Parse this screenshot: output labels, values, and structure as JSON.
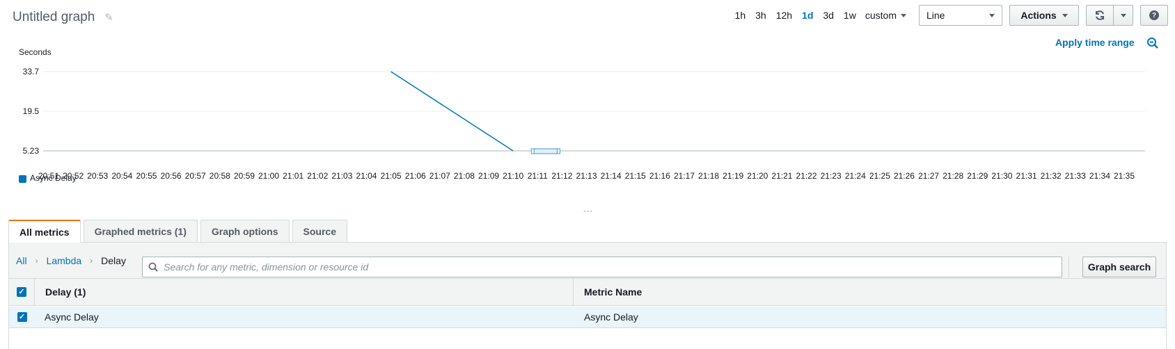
{
  "header": {
    "title": "Untitled graph",
    "edit_icon": "pencil-icon"
  },
  "toolbar": {
    "time_ranges": [
      "1h",
      "3h",
      "12h",
      "1d",
      "3d",
      "1w"
    ],
    "active_range": "1d",
    "custom_label": "custom",
    "graph_type": "Line",
    "actions_label": "Actions",
    "refresh_icon": "refresh-icon",
    "help_icon": "help-icon",
    "apply_time_range": "Apply time range",
    "zoom_icon": "zoom-out-icon"
  },
  "chart_data": {
    "type": "line",
    "ylabel": "Seconds",
    "yticks": [
      "33.7",
      "19.5",
      "5.23"
    ],
    "ylim": [
      5.23,
      33.7
    ],
    "x_categories": [
      "20:51",
      "20:52",
      "20:53",
      "20:54",
      "20:55",
      "20:56",
      "20:57",
      "20:58",
      "20:59",
      "21:00",
      "21:01",
      "21:02",
      "21:03",
      "21:04",
      "21:05",
      "21:06",
      "21:07",
      "21:08",
      "21:09",
      "21:10",
      "21:11",
      "21:12",
      "21:13",
      "21:14",
      "21:15",
      "21:16",
      "21:17",
      "21:18",
      "21:19",
      "21:20",
      "21:21",
      "21:22",
      "21:23",
      "21:24",
      "21:25",
      "21:26",
      "21:27",
      "21:28",
      "21:29",
      "21:30",
      "21:31",
      "21:32",
      "21:33",
      "21:34",
      "21:35"
    ],
    "series": [
      {
        "name": "Async Delay",
        "color": "#0073bb",
        "points": [
          {
            "x": "21:05",
            "y": 33.7
          },
          {
            "x": "21:10",
            "y": 5.23
          }
        ]
      }
    ],
    "selection_range": [
      "21:11",
      "21:12"
    ],
    "grid": true,
    "legend": "bottom-left"
  },
  "tabs": [
    {
      "label": "All metrics",
      "active": true
    },
    {
      "label": "Graphed metrics (1)",
      "active": false
    },
    {
      "label": "Graph options",
      "active": false
    },
    {
      "label": "Source",
      "active": false
    }
  ],
  "browser": {
    "breadcrumb": [
      "All",
      "Lambda",
      "Delay"
    ],
    "search_placeholder": "Search for any metric, dimension or resource id",
    "graph_search_label": "Graph search",
    "columns": [
      "Delay  (1)",
      "Metric Name"
    ],
    "rows": [
      {
        "delay": "Async Delay",
        "metric_name": "Async Delay",
        "checked": true
      }
    ]
  }
}
